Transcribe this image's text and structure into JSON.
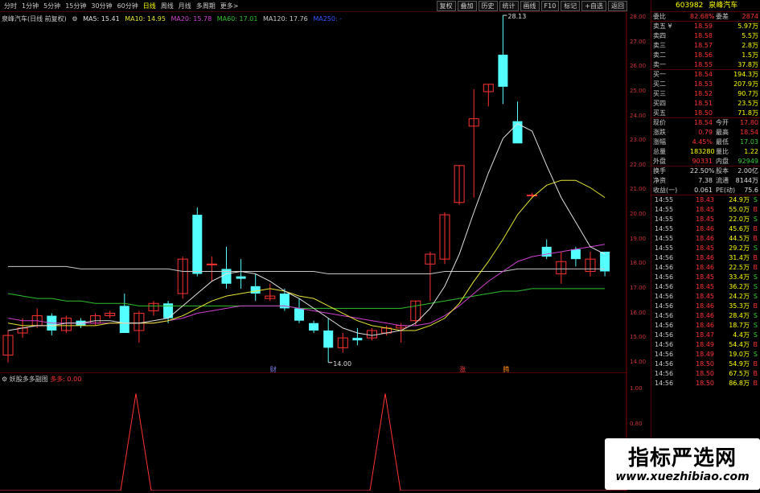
{
  "toolbar": {
    "tabs": [
      "分时",
      "1分钟",
      "5分钟",
      "15分钟",
      "30分钟",
      "60分钟",
      "日线",
      "周线",
      "月线",
      "多周期",
      "更多>"
    ],
    "active_tab": "日线",
    "buttons": [
      "复权",
      "叠加",
      "历史",
      "统计",
      "画线",
      "F10",
      "标记",
      "+自选",
      "返回"
    ]
  },
  "info": {
    "name": "泉峰汽车(日线 前复权)",
    "ma5": "MA5: 15.41",
    "ma10": "MA10: 14.95",
    "ma20": "MA20: 15.78",
    "ma60": "MA60: 17.01",
    "ma120": "MA120: 17.76",
    "ma250": "MA250: -"
  },
  "chart_labels": {
    "high": "28.13",
    "low": "14.00",
    "marker1": "财",
    "marker2": "涨",
    "marker3": "腾"
  },
  "axis": [
    "28.00",
    "27.00",
    "26.00",
    "25.00",
    "24.00",
    "23.00",
    "22.00",
    "21.00",
    "20.00",
    "19.00",
    "18.00",
    "17.00",
    "16.00",
    "15.00",
    "14.00"
  ],
  "sub": {
    "title": "妖股多多副图",
    "line": "多多: 0.00",
    "axis": [
      "1.00",
      "0.80",
      "0.60"
    ]
  },
  "candles": [
    [
      14.3,
      15.3,
      14.0,
      15.1
    ],
    [
      15.2,
      15.8,
      15.0,
      15.4
    ],
    [
      15.5,
      16.2,
      15.4,
      15.9
    ],
    [
      15.9,
      16.0,
      15.1,
      15.3
    ],
    [
      15.3,
      15.9,
      15.2,
      15.8
    ],
    [
      15.7,
      15.8,
      15.4,
      15.5
    ],
    [
      15.6,
      16.0,
      15.5,
      15.9
    ],
    [
      15.9,
      16.1,
      15.8,
      16.0
    ],
    [
      16.3,
      16.8,
      15.2,
      15.2
    ],
    [
      15.3,
      16.1,
      14.8,
      16.0
    ],
    [
      16.1,
      16.5,
      15.9,
      16.4
    ],
    [
      16.4,
      16.5,
      15.6,
      15.8
    ],
    [
      16.8,
      18.3,
      16.6,
      18.2
    ],
    [
      20.0,
      20.3,
      17.5,
      17.6
    ],
    [
      18.0,
      18.3,
      17.3,
      18.0
    ],
    [
      17.8,
      18.7,
      17.0,
      17.2
    ],
    [
      17.5,
      18.2,
      17.0,
      17.4
    ],
    [
      17.1,
      17.6,
      16.5,
      16.8
    ],
    [
      16.6,
      17.2,
      16.5,
      16.7
    ],
    [
      16.8,
      17.0,
      16.1,
      16.2
    ],
    [
      16.2,
      16.6,
      15.6,
      15.7
    ],
    [
      15.6,
      15.7,
      15.2,
      15.3
    ],
    [
      15.3,
      15.8,
      14.0,
      14.6
    ],
    [
      14.6,
      15.2,
      14.4,
      15.0
    ],
    [
      15.0,
      15.4,
      14.7,
      14.9
    ],
    [
      15.0,
      15.4,
      14.9,
      15.3
    ],
    [
      15.2,
      15.5,
      15.1,
      15.4
    ],
    [
      15.4,
      15.6,
      14.8,
      15.5
    ],
    [
      15.7,
      16.5,
      15.5,
      16.5
    ],
    [
      18.0,
      18.5,
      16.5,
      18.4
    ],
    [
      18.2,
      20.1,
      18.0,
      20.0
    ],
    [
      20.5,
      22.0,
      20.4,
      22.0
    ],
    [
      23.6,
      25.1,
      20.7,
      23.9
    ],
    [
      25.0,
      25.3,
      24.4,
      25.3
    ],
    [
      26.5,
      28.1,
      24.5,
      25.2
    ],
    [
      23.8,
      24.6,
      22.9,
      22.9
    ],
    [
      20.8,
      20.9,
      20.7,
      20.8
    ],
    [
      18.7,
      19.0,
      18.2,
      18.3
    ],
    [
      17.6,
      18.5,
      17.2,
      18.1
    ],
    [
      18.6,
      18.7,
      17.9,
      18.2
    ],
    [
      17.7,
      18.5,
      17.5,
      18.2
    ],
    [
      18.5,
      18.5,
      17.5,
      17.7
    ]
  ],
  "ma": {
    "ma5": [
      15.3,
      15.4,
      15.5,
      15.5,
      15.6,
      15.6,
      15.7,
      15.7,
      15.6,
      15.6,
      15.7,
      15.8,
      16.3,
      16.8,
      17.3,
      17.6,
      17.7,
      17.6,
      17.3,
      16.9,
      16.6,
      16.2,
      15.8,
      15.4,
      15.2,
      15.1,
      15.2,
      15.3,
      15.6,
      16.2,
      17.1,
      18.4,
      20.1,
      21.7,
      23.1,
      23.7,
      23.4,
      22.0,
      20.7,
      19.7,
      18.7,
      18.4
    ],
    "ma10": [
      15.6,
      15.5,
      15.5,
      15.5,
      15.5,
      15.5,
      15.5,
      15.6,
      15.6,
      15.6,
      15.6,
      15.7,
      15.9,
      16.2,
      16.5,
      16.7,
      16.8,
      16.9,
      17.0,
      16.9,
      16.7,
      16.6,
      16.3,
      16.0,
      15.7,
      15.5,
      15.4,
      15.3,
      15.3,
      15.5,
      15.8,
      16.4,
      17.3,
      18.1,
      19.0,
      20.0,
      20.7,
      21.2,
      21.4,
      21.4,
      21.1,
      20.7
    ],
    "ma20": [
      15.8,
      15.7,
      15.7,
      15.6,
      15.6,
      15.6,
      15.6,
      15.6,
      15.6,
      15.6,
      15.6,
      15.7,
      15.8,
      16.0,
      16.1,
      16.2,
      16.3,
      16.3,
      16.3,
      16.3,
      16.2,
      16.1,
      16.0,
      15.9,
      15.8,
      15.7,
      15.6,
      15.5,
      15.5,
      15.6,
      15.9,
      16.3,
      16.8,
      17.3,
      17.7,
      18.1,
      18.3,
      18.4,
      18.5,
      18.6,
      18.7,
      18.8
    ],
    "ma60": [
      16.8,
      16.7,
      16.6,
      16.6,
      16.5,
      16.5,
      16.4,
      16.4,
      16.4,
      16.3,
      16.3,
      16.3,
      16.3,
      16.3,
      16.3,
      16.3,
      16.3,
      16.3,
      16.3,
      16.3,
      16.2,
      16.2,
      16.2,
      16.2,
      16.2,
      16.2,
      16.2,
      16.2,
      16.3,
      16.4,
      16.5,
      16.6,
      16.7,
      16.8,
      16.9,
      16.9,
      17.0,
      17.0,
      17.0,
      17.0,
      17.0,
      17.0
    ],
    "ma120": [
      17.9,
      17.9,
      17.9,
      17.9,
      17.9,
      17.8,
      17.8,
      17.8,
      17.8,
      17.8,
      17.8,
      17.8,
      17.7,
      17.7,
      17.7,
      17.7,
      17.7,
      17.7,
      17.7,
      17.7,
      17.7,
      17.7,
      17.6,
      17.6,
      17.6,
      17.6,
      17.6,
      17.6,
      17.6,
      17.6,
      17.7,
      17.7,
      17.7,
      17.7,
      17.7,
      17.8,
      17.8,
      17.8,
      17.8,
      17.8,
      17.8,
      17.8
    ]
  },
  "colors": {
    "up": "#ff3232",
    "down": "#54ffff",
    "ma5": "#e0e0e0",
    "ma10": "#e6e632",
    "ma20": "#d040d0",
    "ma60": "#30c030",
    "ma120": "#c8c8c8"
  },
  "quote": {
    "code": "603982",
    "name": "泉峰汽车",
    "weibi": [
      "委比",
      "82.68%",
      "委差",
      "2874"
    ],
    "asks": [
      [
        "卖五 ¥",
        "18.59",
        "5.97万"
      ],
      [
        "卖四",
        "18.58",
        "5.5万"
      ],
      [
        "卖三",
        "18.57",
        "2.8万"
      ],
      [
        "卖二",
        "18.56",
        "1.5万"
      ],
      [
        "卖一",
        "18.55",
        "37.8万"
      ]
    ],
    "bids": [
      [
        "买一",
        "18.54",
        "194.3万"
      ],
      [
        "买二",
        "18.53",
        "207.9万"
      ],
      [
        "买三",
        "18.52",
        "90.7万"
      ],
      [
        "买四",
        "18.51",
        "23.5万"
      ],
      [
        "买五",
        "18.50",
        "71.8万"
      ]
    ],
    "stats": [
      [
        "现价",
        "18.54",
        "今开",
        "17.80"
      ],
      [
        "涨跌",
        "0.79",
        "最高",
        "18.54"
      ],
      [
        "涨幅",
        "4.45%",
        "最低",
        "17.03"
      ],
      [
        "总量",
        "183280",
        "量比",
        "1.22"
      ],
      [
        "外盘",
        "90331",
        "内盘",
        "92949"
      ]
    ],
    "stats2": [
      [
        "换手",
        "22.50%",
        "股本",
        "2.00亿"
      ],
      [
        "净资",
        "7.38",
        "流通",
        "8144万"
      ],
      [
        "收益(一)",
        "0.061",
        "PE(动)",
        "75.6"
      ]
    ]
  },
  "ticks": [
    [
      "14:55",
      "18.43",
      "24.9万",
      "S"
    ],
    [
      "14:55",
      "18.45",
      "55.0万",
      "B"
    ],
    [
      "14:55",
      "18.45",
      "22.0万",
      "S"
    ],
    [
      "14:55",
      "18.46",
      "45.6万",
      "B"
    ],
    [
      "14:55",
      "18.46",
      "44.5万",
      "B"
    ],
    [
      "14:55",
      "18.45",
      "29.2万",
      "S"
    ],
    [
      "14:56",
      "18.46",
      "31.4万",
      "B"
    ],
    [
      "14:56",
      "18.46",
      "22.5万",
      "B"
    ],
    [
      "14:56",
      "18.45",
      "33.4万",
      "S"
    ],
    [
      "14:56",
      "18.45",
      "36.2万",
      "S"
    ],
    [
      "14:56",
      "18.45",
      "24.2万",
      "S"
    ],
    [
      "14:56",
      "18.46",
      "35.3万",
      "B"
    ],
    [
      "14:56",
      "18.46",
      "28.4万",
      "S"
    ],
    [
      "14:56",
      "18.46",
      "18.7万",
      "S"
    ],
    [
      "14:56",
      "18.47",
      "4.4万",
      "S"
    ],
    [
      "14:56",
      "18.49",
      "54.4万",
      "B"
    ],
    [
      "14:56",
      "18.49",
      "19.0万",
      "S"
    ],
    [
      "14:56",
      "18.50",
      "54.9万",
      "B"
    ],
    [
      "14:56",
      "18.50",
      "67.5万",
      "B"
    ],
    [
      "14:56",
      "18.50",
      "86.8万",
      "B"
    ]
  ],
  "watermark": {
    "title": "指标严选网",
    "url": "www.xuezhibiao.com"
  }
}
